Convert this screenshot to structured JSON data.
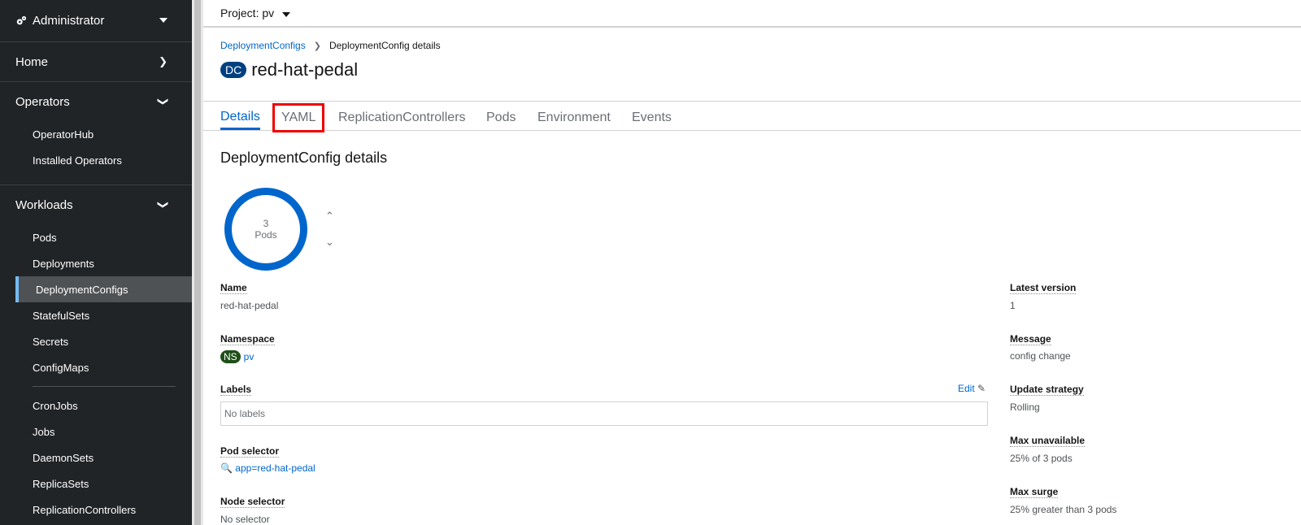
{
  "sidebar": {
    "perspective": "Administrator",
    "sections": {
      "home": "Home",
      "operators": "Operators",
      "workloads": "Workloads"
    },
    "operators_items": [
      "OperatorHub",
      "Installed Operators"
    ],
    "workloads_items": [
      "Pods",
      "Deployments",
      "DeploymentConfigs",
      "StatefulSets",
      "Secrets",
      "ConfigMaps"
    ],
    "workloads_items_2": [
      "CronJobs",
      "Jobs",
      "DaemonSets",
      "ReplicaSets",
      "ReplicationControllers"
    ],
    "active_item": "DeploymentConfigs"
  },
  "topbar": {
    "project_label": "Project: pv"
  },
  "breadcrumb": {
    "parent": "DeploymentConfigs",
    "current": "DeploymentConfig details"
  },
  "title": {
    "badge": "DC",
    "name": "red-hat-pedal"
  },
  "tabs": [
    "Details",
    "YAML",
    "ReplicationControllers",
    "Pods",
    "Environment",
    "Events"
  ],
  "section_title": "DeploymentConfig details",
  "pods": {
    "count": "3",
    "label": "Pods"
  },
  "left_fields": {
    "name_label": "Name",
    "name_value": "red-hat-pedal",
    "namespace_label": "Namespace",
    "namespace_badge": "NS",
    "namespace_value": "pv",
    "labels_label": "Labels",
    "labels_edit": "Edit",
    "labels_value": "No labels",
    "pod_selector_label": "Pod selector",
    "pod_selector_value": "app=red-hat-pedal",
    "node_selector_label": "Node selector",
    "node_selector_value": "No selector"
  },
  "right_fields": {
    "latest_version_label": "Latest version",
    "latest_version_value": "1",
    "message_label": "Message",
    "message_value": "config change",
    "update_strategy_label": "Update strategy",
    "update_strategy_value": "Rolling",
    "max_unavailable_label": "Max unavailable",
    "max_unavailable_value": "25% of 3 pods",
    "max_surge_label": "Max surge",
    "max_surge_value": "25% greater than 3 pods"
  },
  "colors": {
    "accent": "#0066cc",
    "sidebar": "#212427",
    "highlight": "#ee0000"
  }
}
